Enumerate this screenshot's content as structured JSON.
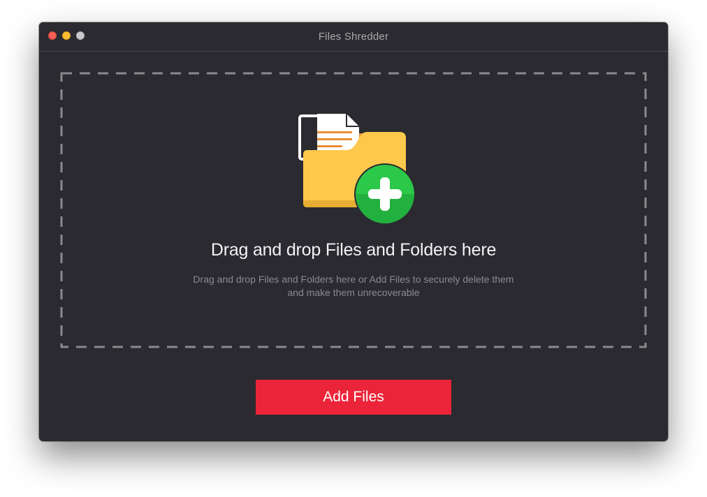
{
  "window": {
    "title": "Files Shredder"
  },
  "dropzone": {
    "heading": "Drag and drop Files and Folders here",
    "subtext": "Drag and drop Files and Folders here or Add Files to  securely delete them and make them unrecoverable",
    "icon": "folder-add-icon"
  },
  "actions": {
    "add_files_label": "Add Files"
  },
  "colors": {
    "window_bg": "#2b2a30",
    "accent": "#ec2439",
    "folder": "#fdc94c",
    "plus_badge": "#2bc84a"
  }
}
